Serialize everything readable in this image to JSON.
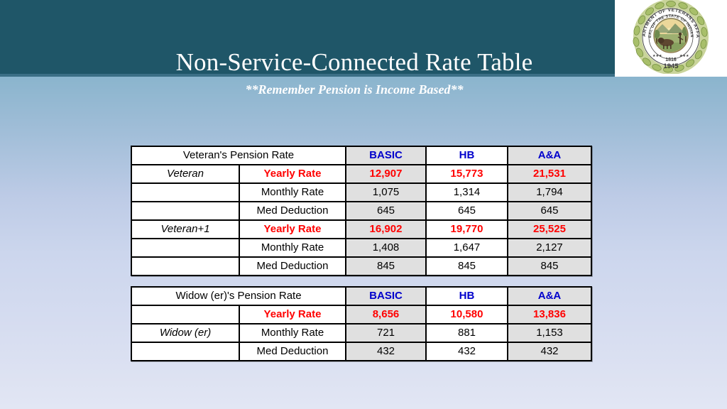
{
  "header": {
    "title": "Non-Service-Connected Rate Table",
    "subtitle": "**Remember Pension is Income Based**",
    "band_color": "#1f5668",
    "seal": {
      "name": "indiana-department-of-veterans-affairs-seal",
      "outer_text": "DEPARTMENT OF VETERANS AFFAIRS",
      "inner_text": "SEAL OF THE STATE OF INDIANA",
      "year_top": "1816",
      "year_bottom": "1945"
    }
  },
  "colors": {
    "accent_blue": "#0000cc",
    "accent_red": "#ff0000",
    "shade_gray": "#e0e0e0",
    "header_teal": "#1f5668"
  },
  "tables": [
    {
      "id": "veteran",
      "title": "Veteran's Pension Rate",
      "columns": [
        "BASIC",
        "HB",
        "A&A"
      ],
      "rows": [
        {
          "group": "Veteran",
          "label": "Yearly Rate",
          "emphasis": "yearly",
          "values": [
            "12,907",
            "15,773",
            "21,531"
          ]
        },
        {
          "group": "",
          "label": "Monthly Rate",
          "emphasis": "normal",
          "values": [
            "1,075",
            "1,314",
            "1,794"
          ]
        },
        {
          "group": "",
          "label": "Med Deduction",
          "emphasis": "normal",
          "values": [
            "645",
            "645",
            "645"
          ]
        },
        {
          "group": "Veteran+1",
          "label": "Yearly Rate",
          "emphasis": "yearly",
          "values": [
            "16,902",
            "19,770",
            "25,525"
          ]
        },
        {
          "group": "",
          "label": "Monthly Rate",
          "emphasis": "normal",
          "values": [
            "1,408",
            "1,647",
            "2,127"
          ]
        },
        {
          "group": "",
          "label": "Med Deduction",
          "emphasis": "normal",
          "values": [
            "845",
            "845",
            "845"
          ]
        }
      ]
    },
    {
      "id": "widow",
      "title": "Widow (er)'s Pension Rate",
      "columns": [
        "BASIC",
        "HB",
        "A&A"
      ],
      "rows": [
        {
          "group": "",
          "label": "Yearly Rate",
          "emphasis": "yearly",
          "values": [
            "8,656",
            "10,580",
            "13,836"
          ]
        },
        {
          "group": "Widow (er)",
          "label": "Monthly Rate",
          "emphasis": "normal",
          "values": [
            "721",
            "881",
            "1,153"
          ]
        },
        {
          "group": "",
          "label": "Med Deduction",
          "emphasis": "normal",
          "values": [
            "432",
            "432",
            "432"
          ]
        }
      ]
    }
  ]
}
